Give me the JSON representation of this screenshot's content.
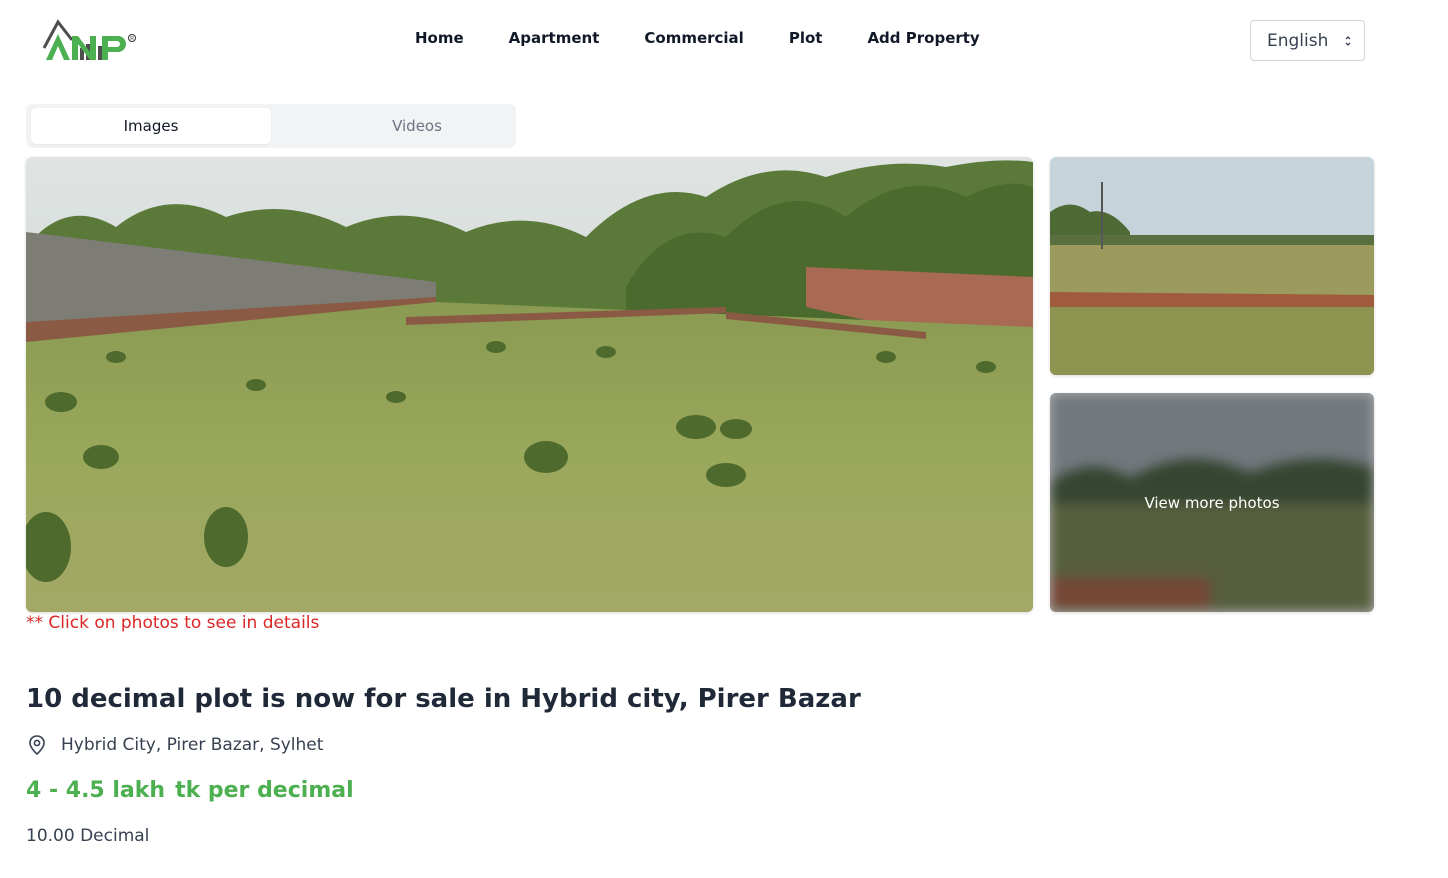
{
  "header": {
    "logo_text": "ANP",
    "logo_mark": "®",
    "nav": [
      "Home",
      "Apartment",
      "Commercial",
      "Plot",
      "Add Property"
    ],
    "language": "English"
  },
  "tabs": [
    {
      "label": "Images",
      "active": true
    },
    {
      "label": "Videos",
      "active": false
    }
  ],
  "gallery": {
    "view_more_label": "View more photos",
    "hint": "** Click on photos to see in details"
  },
  "listing": {
    "title": "10 decimal plot is now for sale in Hybrid city, Pirer Bazar",
    "location": "Hybrid City, Pirer Bazar, Sylhet",
    "price_range": "4 - 4.5 lakh",
    "price_unit": "tk per decimal",
    "size": "10.00 Decimal"
  },
  "colors": {
    "brand_green": "#4caf50",
    "hint_red": "#dc2626",
    "text_dark": "#1f2937"
  },
  "icons": {
    "location": "map-pin-icon",
    "select": "select-arrows-icon"
  }
}
